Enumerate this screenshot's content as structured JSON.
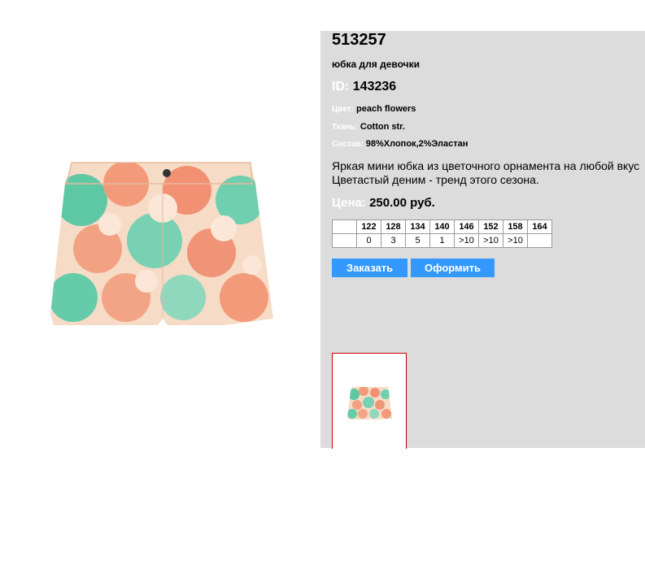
{
  "product": {
    "article": "513257",
    "subtitle": "юбка для девочки",
    "id_label": "ID:",
    "id_value": "143236",
    "color_label": "Цвет:",
    "color_value": "peach flowers",
    "fabric_label": "Ткань:",
    "fabric_value": "Cotton str.",
    "composition_label": "Состав:",
    "composition_value": "98%Хлопок,2%Эластан",
    "description_line1": "Яркая мини юбка из цветочного орнамента на любой вкус",
    "description_line2": "Цветастый деним - тренд этого сезона.",
    "price_label": "Цена:",
    "price_value": "250.00 руб."
  },
  "sizes": {
    "headers": [
      "122",
      "128",
      "134",
      "140",
      "146",
      "152",
      "158",
      "164"
    ],
    "stock": [
      "0",
      "3",
      "5",
      "1",
      ">10",
      ">10",
      ">10",
      ""
    ]
  },
  "buttons": {
    "order": "Заказать",
    "checkout": "Оформить"
  },
  "colors": {
    "button": "#3399ff",
    "panel": "#dcdcdc",
    "thumb_border": "#cc0000"
  }
}
